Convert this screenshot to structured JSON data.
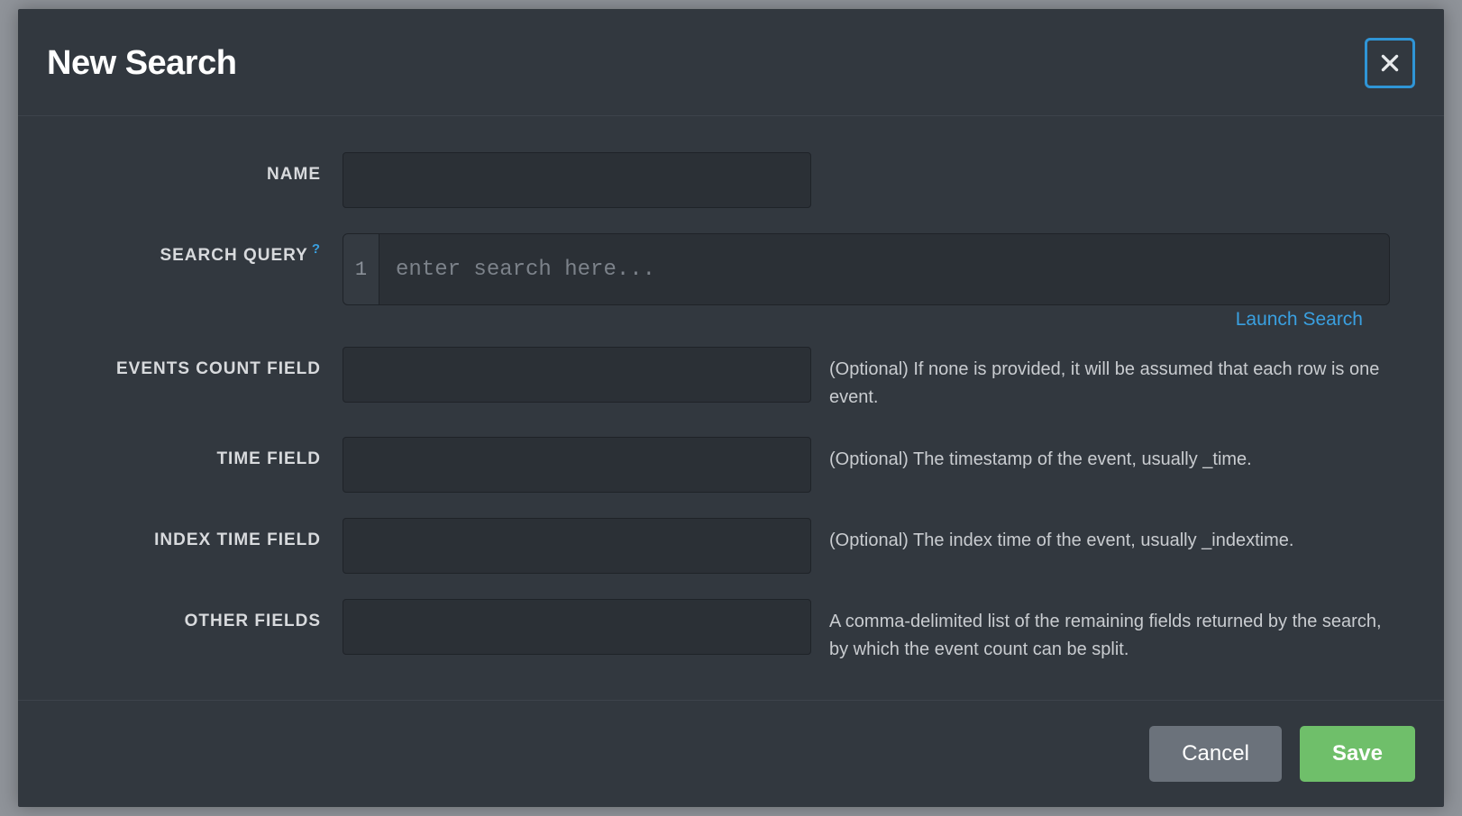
{
  "modal": {
    "title": "New Search",
    "labels": {
      "name": "NAME",
      "search_query": "SEARCH QUERY",
      "events_count_field": "EVENTS COUNT FIELD",
      "time_field": "TIME FIELD",
      "index_time_field": "INDEX TIME FIELD",
      "other_fields": "OTHER FIELDS"
    },
    "help_indicator": "?",
    "search_editor": {
      "line_number": "1",
      "placeholder": "enter search here..."
    },
    "launch_search_label": "Launch Search",
    "hints": {
      "events_count_field": "(Optional) If none is provided, it will be assumed that each row is one event.",
      "time_field": "(Optional) The timestamp of the event, usually _time.",
      "index_time_field": "(Optional) The index time of the event, usually _indextime.",
      "other_fields": "A comma-delimited list of the remaining fields returned by the search, by which the event count can be split."
    },
    "values": {
      "name": "",
      "search_query": "",
      "events_count_field": "",
      "time_field": "",
      "index_time_field": "",
      "other_fields": ""
    },
    "buttons": {
      "cancel": "Cancel",
      "save": "Save"
    }
  }
}
